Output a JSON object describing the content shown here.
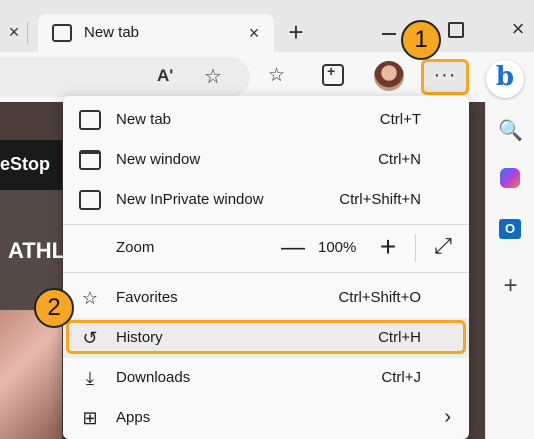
{
  "tabs": {
    "prev_tab_close": "×",
    "active_tab_label": "New tab",
    "active_tab_close": "×",
    "new_tab_glyph": "+",
    "window_close": "×"
  },
  "toolbar": {
    "read_aloud_glyph": "Aʹ",
    "favorite_add_glyph": "☆",
    "favorites_glyph": "☆",
    "more_glyph": "···",
    "copilot_glyph": "b"
  },
  "page": {
    "brand_text": "eStop",
    "hero_text": "ATHL"
  },
  "sidebar": {
    "search_glyph": "🔍",
    "outlook_glyph": "O",
    "add_glyph": "+"
  },
  "menu": {
    "items": [
      {
        "label": "New tab",
        "shortcut": "Ctrl+T",
        "icon": "new-tab-icon"
      },
      {
        "label": "New window",
        "shortcut": "Ctrl+N",
        "icon": "window-icon"
      },
      {
        "label": "New InPrivate window",
        "shortcut": "Ctrl+Shift+N",
        "icon": "inprivate-icon"
      },
      {
        "label": "Zoom",
        "icon": "zoom-icon"
      },
      {
        "label": "Favorites",
        "shortcut": "Ctrl+Shift+O",
        "icon": "favorites-icon"
      },
      {
        "label": "History",
        "shortcut": "Ctrl+H",
        "icon": "history-icon"
      },
      {
        "label": "Downloads",
        "shortcut": "Ctrl+J",
        "icon": "download-icon"
      },
      {
        "label": "Apps",
        "icon": "apps-icon"
      }
    ],
    "zoom": {
      "minus": "—",
      "value": "100%",
      "plus": "+",
      "fullscreen_glyph": "⤢"
    },
    "apps_chevron": "›"
  },
  "annotations": {
    "step1": "1",
    "step2": "2",
    "highlight_color": "#f5a623"
  }
}
